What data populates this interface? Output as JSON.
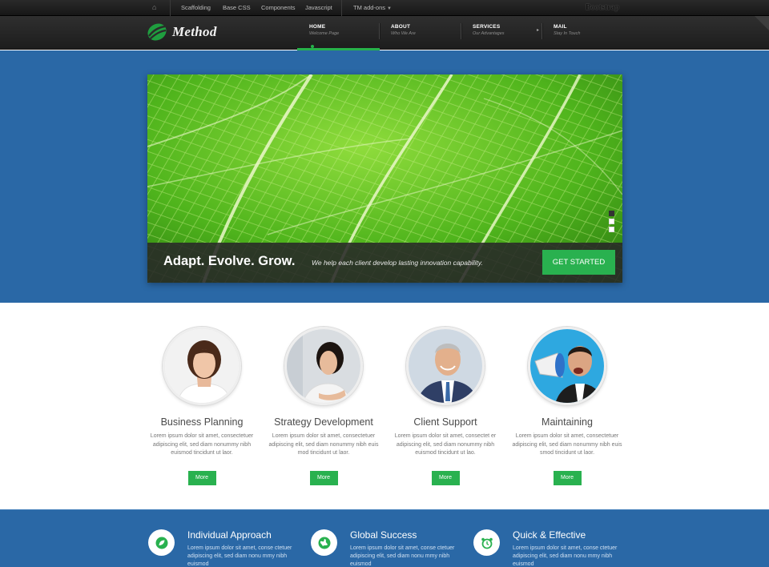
{
  "topbar": {
    "links": [
      "Scaffolding",
      "Base CSS",
      "Components",
      "Javascript",
      "TM add-ons"
    ],
    "brand": "Bootstrap"
  },
  "header": {
    "logo_text": "Method",
    "nav": [
      {
        "title": "HOME",
        "subtitle": "Welcome Page"
      },
      {
        "title": "ABOUT",
        "subtitle": "Who We Are"
      },
      {
        "title": "SERVICES",
        "subtitle": "Our Advantages"
      },
      {
        "title": "MAIL",
        "subtitle": "Stay In Touch"
      }
    ]
  },
  "hero": {
    "headline": "Adapt. Evolve. Grow.",
    "tagline": "We help each client develop lasting innovation capability.",
    "cta_label": "GET STARTED"
  },
  "features": [
    {
      "title": "Business Planning",
      "text": "Lorem ipsum dolor sit amet, consectetuer adipiscing elit, sed diam nonummy nibh euismod tincidunt ut laor.",
      "button": "More"
    },
    {
      "title": "Strategy Development",
      "text": "Lorem ipsum dolor sit amet, consectetuer adipiscing elit, sed diam nonummy nibh euis mod tincidunt ut laor.",
      "button": "More"
    },
    {
      "title": "Client Support",
      "text": "Lorem ipsum dolor sit amet, consectet er adipiscing elit, sed diam nonummy nibh euismod tincidunt ut lao.",
      "button": "More"
    },
    {
      "title": "Maintaining",
      "text": "Lorem ipsum dolor sit amet, consectetuer adipiscing elit, sed diam nonummy nibh euis smod tincidunt ut laor.",
      "button": "More"
    }
  ],
  "bottom": [
    {
      "icon": "leaf-icon",
      "title": "Individual Approach",
      "text": "Lorem ipsum dolor sit amet, conse ctetuer adipiscing elit, sed diam nonu mmy nibh euismod"
    },
    {
      "icon": "globe-icon",
      "title": "Global Success",
      "text": "Lorem ipsum dolor sit amet, conse ctetuer adipiscing elit, sed diam nonu mmy nibh euismod"
    },
    {
      "icon": "alarm-clock-icon",
      "title": "Quick & Effective",
      "text": "Lorem ipsum dolor sit amet, conse ctetuer adipiscing elit, sed diam nonu mmy nibh euismod"
    }
  ],
  "colors": {
    "brand_green": "#29b14f",
    "band_blue": "#2a68a6",
    "header_dark": "#262626"
  }
}
